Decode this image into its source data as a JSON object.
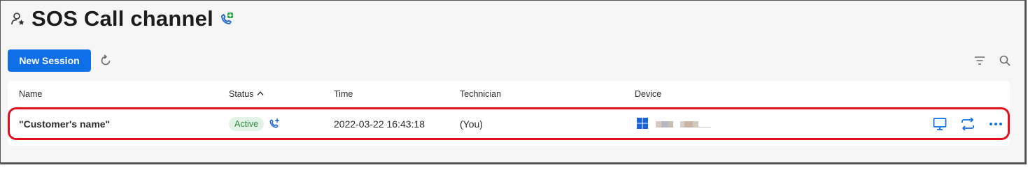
{
  "header": {
    "title": "SOS Call channel",
    "user_icon": "user-star-icon",
    "sos_icon": "phone-plus-icon"
  },
  "toolbar": {
    "new_session_label": "New Session",
    "refresh_icon": "refresh-icon",
    "filter_icon": "filter-icon",
    "search_icon": "search-icon"
  },
  "table": {
    "columns": {
      "name": "Name",
      "status": "Status",
      "time": "Time",
      "technician": "Technician",
      "device": "Device"
    },
    "sort": {
      "column": "Status",
      "direction": "ascending"
    },
    "rows": [
      {
        "name": "\"Customer's name\"",
        "status": "Active",
        "status_icon": "phone-plus-icon",
        "time": "2022-03-22 16:43:18",
        "technician": "(You)",
        "device_os_icon": "windows-icon",
        "actions": [
          "monitor-icon",
          "swap-icon",
          "more-icon"
        ]
      }
    ]
  },
  "colors": {
    "primary": "#0e6fe8",
    "active_badge_bg": "#e4f3e7",
    "active_badge_text": "#2e8b47",
    "highlight": "#e3101e"
  }
}
